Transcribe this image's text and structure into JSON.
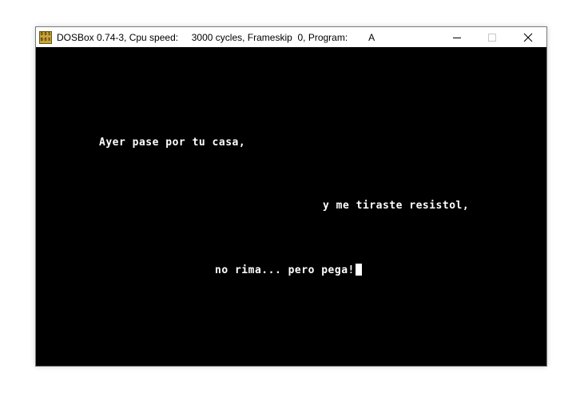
{
  "window": {
    "title": "DOSBox 0.74-3, Cpu speed:     3000 cycles, Frameskip  0, Program:        A",
    "icon": "dosbox-icon",
    "controls": {
      "minimize": "minimize-icon",
      "maximize": "maximize-icon",
      "close": "close-icon"
    }
  },
  "screen": {
    "lines": [
      "Ayer pase por tu casa,",
      "y me tiraste resistol,",
      "no rima... pero pega!"
    ],
    "background": "#000000",
    "foreground": "#ffffff"
  }
}
